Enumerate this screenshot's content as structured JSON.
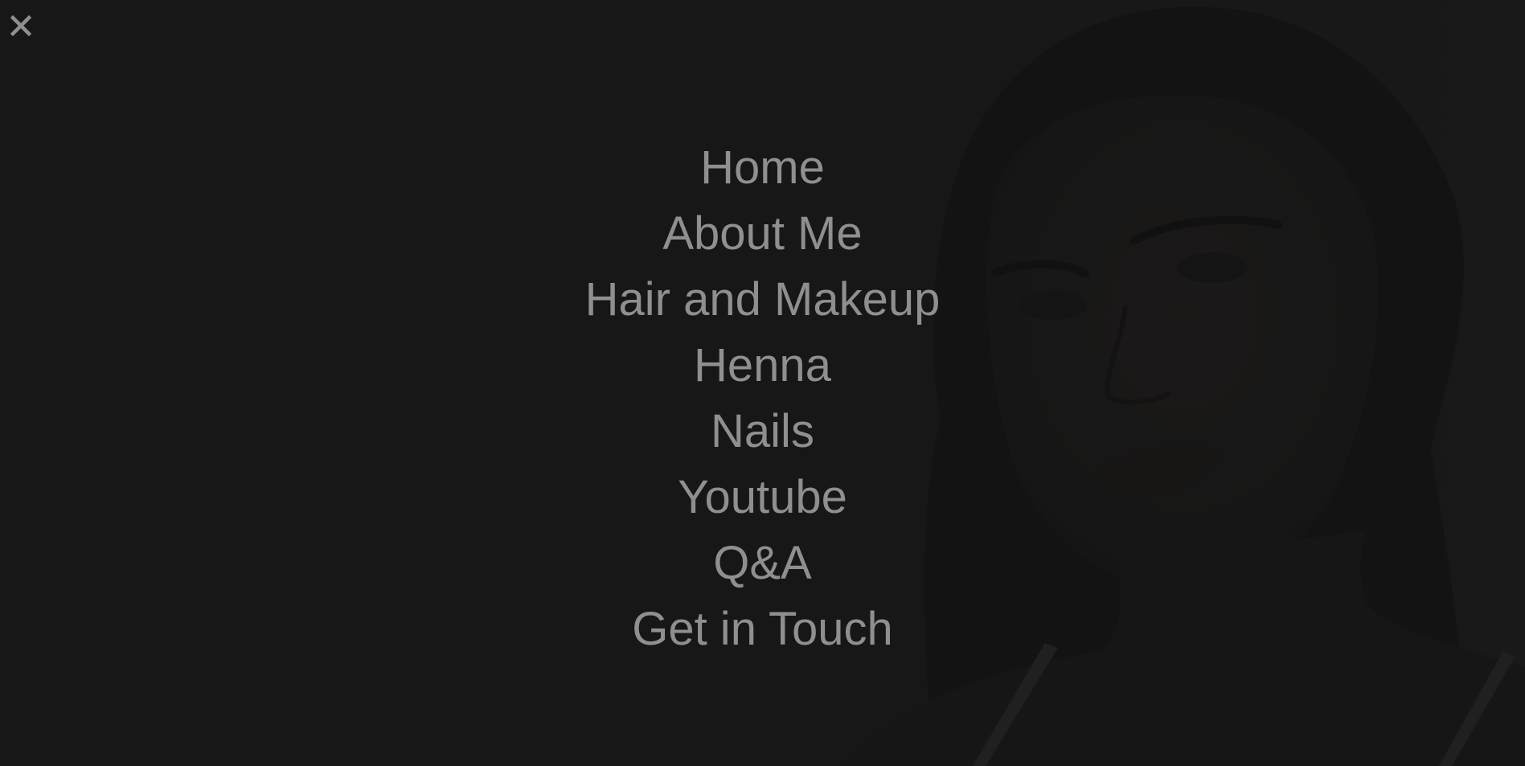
{
  "overlay": {
    "close_icon": "close-icon",
    "close_color": "#8f8f8f"
  },
  "menu": {
    "items": [
      {
        "label": "Home"
      },
      {
        "label": "About Me"
      },
      {
        "label": "Hair and Makeup"
      },
      {
        "label": "Henna"
      },
      {
        "label": "Nails"
      },
      {
        "label": "Youtube"
      },
      {
        "label": "Q&A"
      },
      {
        "label": "Get in Touch"
      }
    ]
  },
  "colors": {
    "background": "#171717",
    "menu_text": "#8f8f8f"
  }
}
